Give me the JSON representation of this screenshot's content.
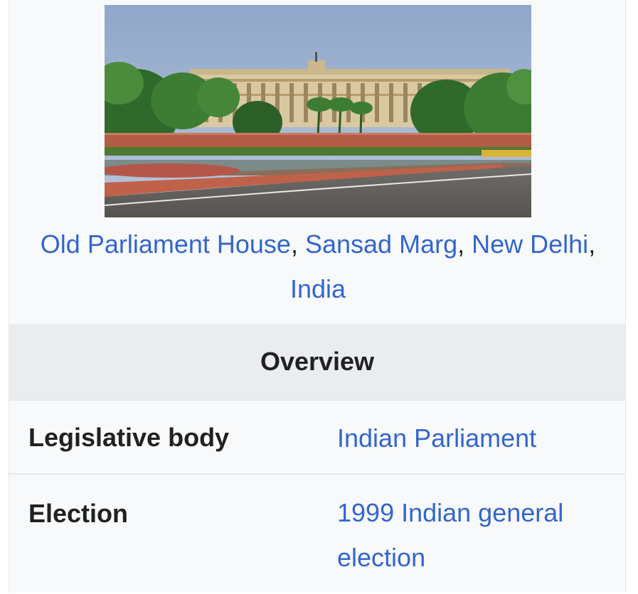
{
  "image": {
    "subject": "parliament-building-photo"
  },
  "caption": {
    "link1": "Old Parliament House",
    "sep1": ", ",
    "link2": "Sansad Marg",
    "sep2": ", ",
    "link3": "New Delhi",
    "sep3": ", ",
    "link4": "India"
  },
  "section_header": "Overview",
  "rows": [
    {
      "label": "Legislative body",
      "value": "Indian Parliament"
    },
    {
      "label": "Election",
      "value": "1999 Indian general election"
    }
  ],
  "colors": {
    "link": "#3366cc",
    "text": "#202122",
    "header_bg": "#eaecf0",
    "box_bg": "#f8f9fa"
  }
}
